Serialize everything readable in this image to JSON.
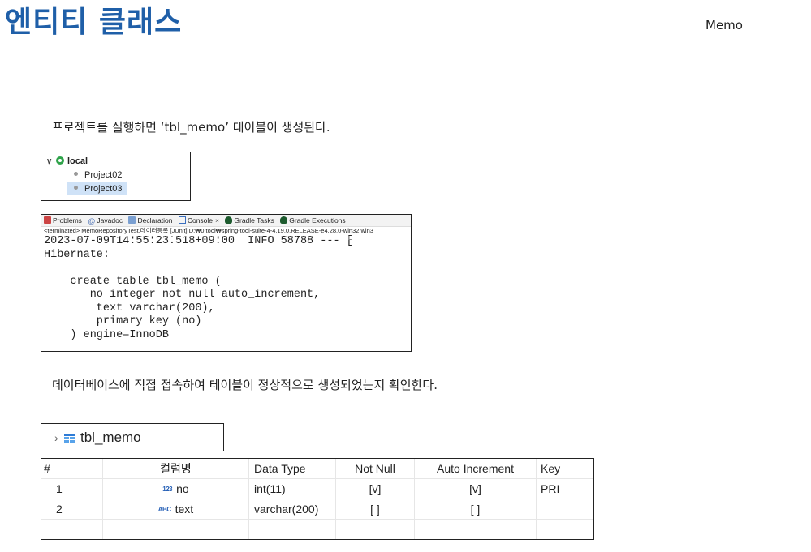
{
  "page": {
    "title": "엔티티 클래스",
    "corner_label": "Memo",
    "para1": "프로젝트를 실행하면 ‘tbl_memo’ 테이블이 생성된다.",
    "para2": "데이터베이스에 직접 접속하여 테이블이 정상적으로 생성되었는지 확인한다."
  },
  "explorer": {
    "root_label": "local",
    "items": [
      "Project02",
      "Project03"
    ],
    "selected_index": 1
  },
  "console": {
    "tabs": [
      {
        "label": "Problems",
        "icon": "problems-icon"
      },
      {
        "label": "Javadoc",
        "icon": "javadoc-icon"
      },
      {
        "label": "Declaration",
        "icon": "declaration-icon"
      },
      {
        "label": "Console",
        "icon": "console-icon",
        "closable": true
      },
      {
        "label": "Gradle Tasks",
        "icon": "gradle-icon"
      },
      {
        "label": "Gradle Executions",
        "icon": "gradle-icon"
      }
    ],
    "close_glyph": "×",
    "terminated_line": "<terminated> MemoRepositoryTest.데이터등록 [JUnit] D:₩0.tool₩spring-tool-suite-4-4.19.0.RELEASE-e4.28.0-win32.win3",
    "cut_line": "2023-07-09T14:55:23.516+09:00  INFO 58788 --- [",
    "lines": [
      "2023-07-09T14:55:23.518+09:00  INFO 58788 --- [",
      "Hibernate:",
      "",
      "    create table tbl_memo (",
      "       no integer not null auto_increment,",
      "        text varchar(200),",
      "        primary key (no)",
      "    ) engine=InnoDB"
    ]
  },
  "table_node": {
    "label": "tbl_memo"
  },
  "columns": {
    "headers": [
      "#",
      "컬럼명",
      "Data Type",
      "Not Null",
      "Auto Increment",
      "Key"
    ],
    "rows": [
      {
        "num": "1",
        "icon": "123",
        "name": "no",
        "type": "int(11)",
        "not_null": "[v]",
        "auto_inc": "[v]",
        "key": "PRI"
      },
      {
        "num": "2",
        "icon": "ABC",
        "name": "text",
        "type": "varchar(200)",
        "not_null": "[ ]",
        "auto_inc": "[ ]",
        "key": ""
      }
    ]
  }
}
